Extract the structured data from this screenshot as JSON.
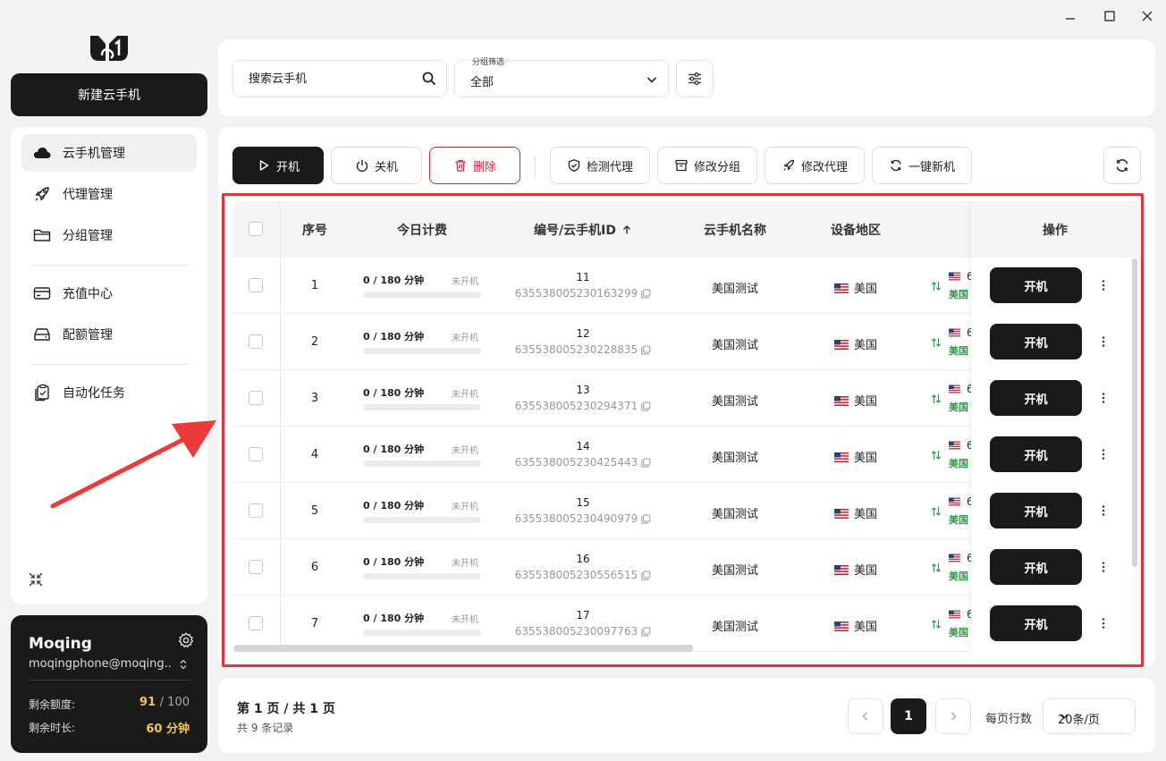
{
  "sidebar": {
    "new_button": "新建云手机",
    "items": [
      {
        "label": "云手机管理",
        "icon": "cloud-icon"
      },
      {
        "label": "代理管理",
        "icon": "rocket-icon"
      },
      {
        "label": "分组管理",
        "icon": "folder-icon"
      },
      {
        "label": "充值中心",
        "icon": "card-icon"
      },
      {
        "label": "配额管理",
        "icon": "storage-icon"
      },
      {
        "label": "自动化任务",
        "icon": "clipboard-icon"
      }
    ]
  },
  "user": {
    "name": "Moqing",
    "email": "moqingphone@moqing....",
    "quota_label": "剩余额度:",
    "quota_used": "91",
    "quota_total": "/ 100",
    "time_label": "剩余时长:",
    "time_value": "60",
    "time_unit": "分钟"
  },
  "filter": {
    "search_placeholder": "搜索云手机",
    "group_label": "分组筛选",
    "group_value": "全部"
  },
  "toolbar": {
    "start": "开机",
    "stop": "关机",
    "delete": "删除",
    "check_proxy": "检测代理",
    "edit_group": "修改分组",
    "edit_proxy": "修改代理",
    "one_click_new": "一键新机"
  },
  "table": {
    "headers": {
      "index": "序号",
      "fee": "今日计费",
      "id": "编号/云手机ID",
      "name": "云手机名称",
      "region": "设备地区",
      "ops": "操作"
    },
    "fee_status": "未开机",
    "proxy_type": "美国",
    "row_action": "开机",
    "rows": [
      {
        "index": "1",
        "fee": "0 / 180 分钟",
        "num": "11",
        "pid": "635538005230163299",
        "name": "美国测试",
        "region": "美国",
        "proxy": "6"
      },
      {
        "index": "2",
        "fee": "0 / 180 分钟",
        "num": "12",
        "pid": "635538005230228835",
        "name": "美国测试",
        "region": "美国",
        "proxy": "6"
      },
      {
        "index": "3",
        "fee": "0 / 180 分钟",
        "num": "13",
        "pid": "635538005230294371",
        "name": "美国测试",
        "region": "美国",
        "proxy": "6"
      },
      {
        "index": "4",
        "fee": "0 / 180 分钟",
        "num": "14",
        "pid": "635538005230425443",
        "name": "美国测试",
        "region": "美国",
        "proxy": "6"
      },
      {
        "index": "5",
        "fee": "0 / 180 分钟",
        "num": "15",
        "pid": "635538005230490979",
        "name": "美国测试",
        "region": "美国",
        "proxy": "6"
      },
      {
        "index": "6",
        "fee": "0 / 180 分钟",
        "num": "16",
        "pid": "635538005230556515",
        "name": "美国测试",
        "region": "美国",
        "proxy": "6"
      },
      {
        "index": "7",
        "fee": "0 / 180 分钟",
        "num": "17",
        "pid": "635538005230097763",
        "name": "美国测试",
        "region": "美国",
        "proxy": "6"
      }
    ]
  },
  "pagination": {
    "page_info": "第 1 页 / 共 1 页",
    "total_info": "共 9 条记录",
    "current_page": "1",
    "rows_label": "每页行数",
    "page_size": "20条/页"
  },
  "colors": {
    "accent_dark": "#1a1a1a",
    "danger": "#cf2a3a",
    "highlight_frame": "#e5333d",
    "quota_yellow": "#f5c645",
    "proxy_green": "#2e9a4a"
  }
}
